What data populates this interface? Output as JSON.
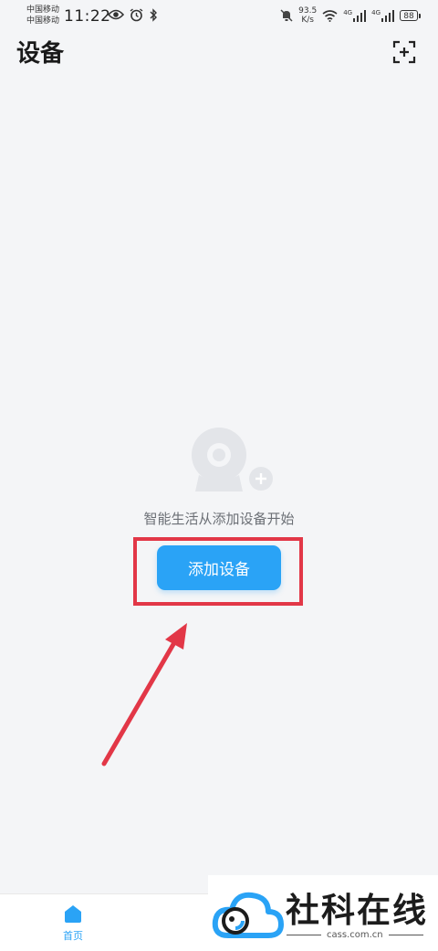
{
  "status_bar": {
    "carrier_1": "中国移动",
    "carrier_2": "中国移动",
    "time": "11:22",
    "speed_value": "93.5",
    "speed_unit": "K/s",
    "sim1_tech": "4G",
    "sim2_tech": "4G",
    "battery": "88",
    "icons": [
      "eye-icon",
      "alarm-icon",
      "bluetooth-icon",
      "mute-icon",
      "wifi-icon",
      "signal-icon",
      "signal-icon",
      "battery-icon"
    ]
  },
  "header": {
    "title": "设备",
    "scan_icon": "scan-add-icon"
  },
  "empty_state": {
    "illustration": "camera-add-icon",
    "message": "智能生活从添加设备开始",
    "add_button_label": "添加设备"
  },
  "bottom_nav": {
    "items": [
      {
        "label": "首页",
        "icon": "home-icon",
        "active": true
      }
    ]
  },
  "watermark": {
    "brand_text": "社科在线",
    "url": "cass.com.cn"
  },
  "colors": {
    "accent": "#2aa3f6",
    "annotation": "#e23747",
    "background": "#f4f5f7"
  }
}
